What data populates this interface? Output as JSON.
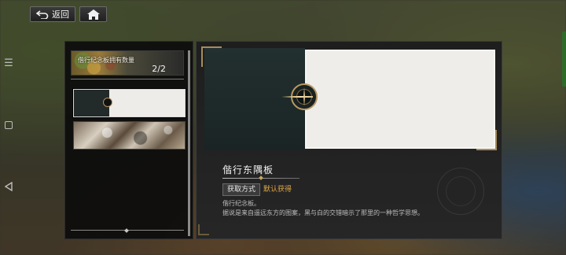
{
  "topbar": {
    "back_label": "返回",
    "back_icon": "return-arrow-icon",
    "home_icon": "home-icon"
  },
  "system_bar": {
    "menu_icon": "menu-icon",
    "home_icon": "square-home-icon",
    "back_icon": "triangle-back-icon"
  },
  "list": {
    "title": "偕行纪念板拥有数量",
    "count": "2/2",
    "items": [
      {
        "name": "偕行东隅板",
        "selected": true
      },
      {
        "name": "",
        "selected": false
      }
    ]
  },
  "detail": {
    "name": "偕行东隅板",
    "source_label": "获取方式",
    "source_value": "默认获得",
    "desc_line1": "偕行纪念板。",
    "desc_line2": "据说是来自遥远东方的图案，黑与白的交错暗示了那里的一种哲学思想。"
  },
  "colors": {
    "accent_gold": "#b79a64",
    "source_value": "#e0a84a",
    "panel_bg": "#1e1e1e"
  }
}
